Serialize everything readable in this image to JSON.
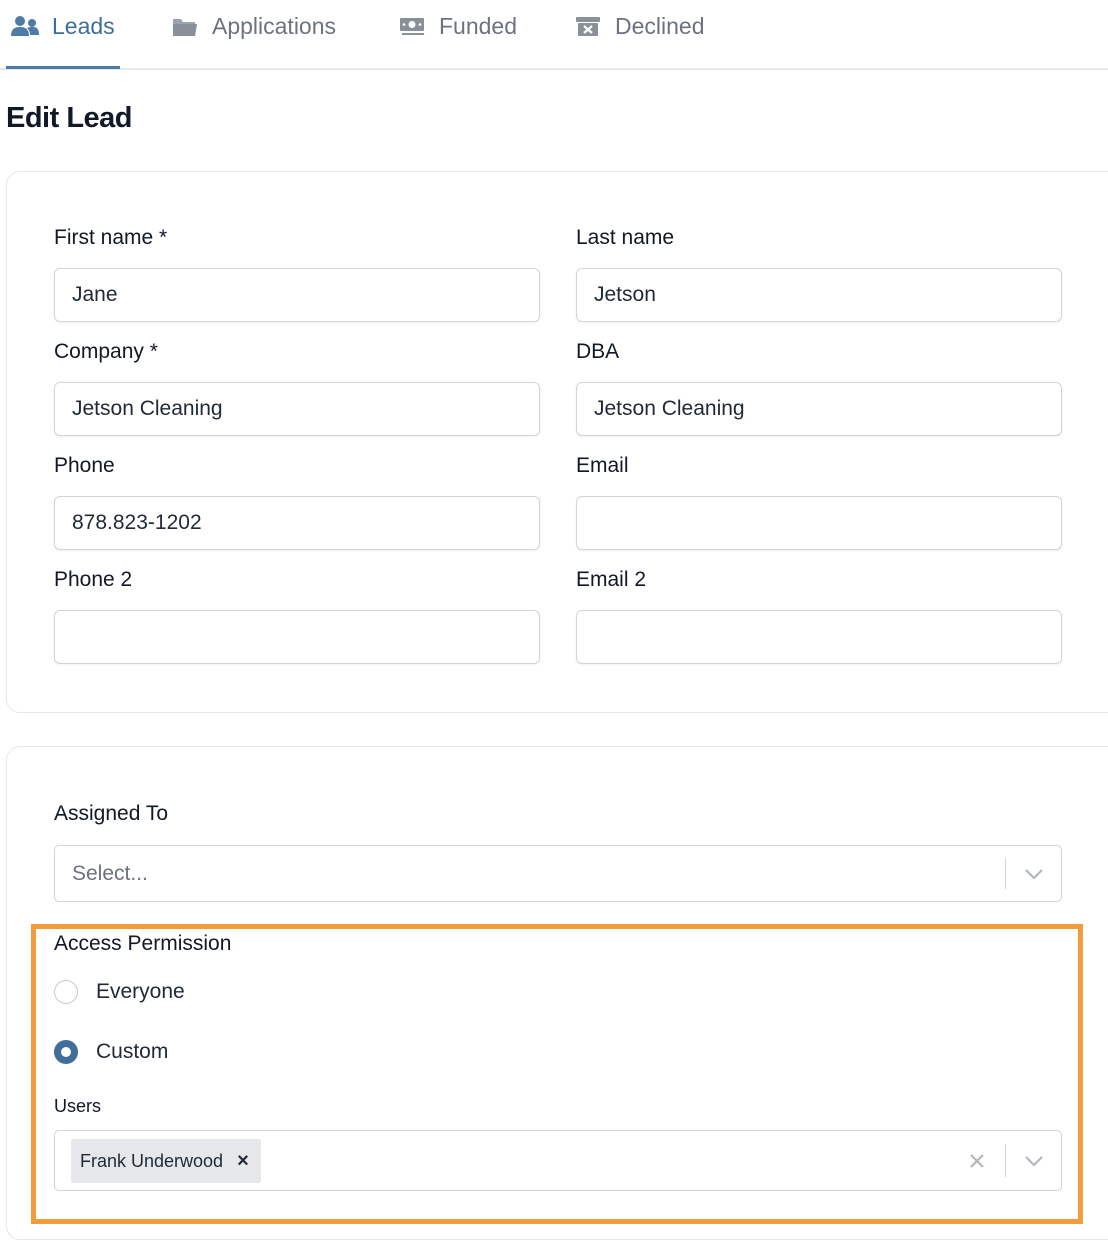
{
  "tabs": [
    {
      "label": "Leads",
      "icon": "users-icon",
      "active": true
    },
    {
      "label": "Applications",
      "icon": "folder-icon",
      "active": false
    },
    {
      "label": "Funded",
      "icon": "money-icon",
      "active": false
    },
    {
      "label": "Declined",
      "icon": "archive-x-icon",
      "active": false
    }
  ],
  "page": {
    "title": "Edit Lead"
  },
  "form": {
    "first_name": {
      "label": "First name *",
      "value": "Jane"
    },
    "last_name": {
      "label": "Last name",
      "value": "Jetson"
    },
    "company": {
      "label": "Company *",
      "value": "Jetson Cleaning"
    },
    "dba": {
      "label": "DBA",
      "value": "Jetson Cleaning"
    },
    "phone": {
      "label": "Phone",
      "value": "878.823-1202"
    },
    "email": {
      "label": "Email",
      "value": ""
    },
    "phone2": {
      "label": "Phone 2",
      "value": ""
    },
    "email2": {
      "label": "Email 2",
      "value": ""
    }
  },
  "assignment": {
    "assigned_to": {
      "label": "Assigned To",
      "placeholder": "Select..."
    },
    "access_permission": {
      "label": "Access Permission",
      "options": [
        {
          "label": "Everyone",
          "checked": false
        },
        {
          "label": "Custom",
          "checked": true
        }
      ]
    },
    "users": {
      "label": "Users",
      "selected": [
        "Frank Underwood"
      ],
      "remove_glyph": "×"
    }
  },
  "colors": {
    "accent": "#3f6e9b",
    "highlight": "#f39c3c"
  }
}
